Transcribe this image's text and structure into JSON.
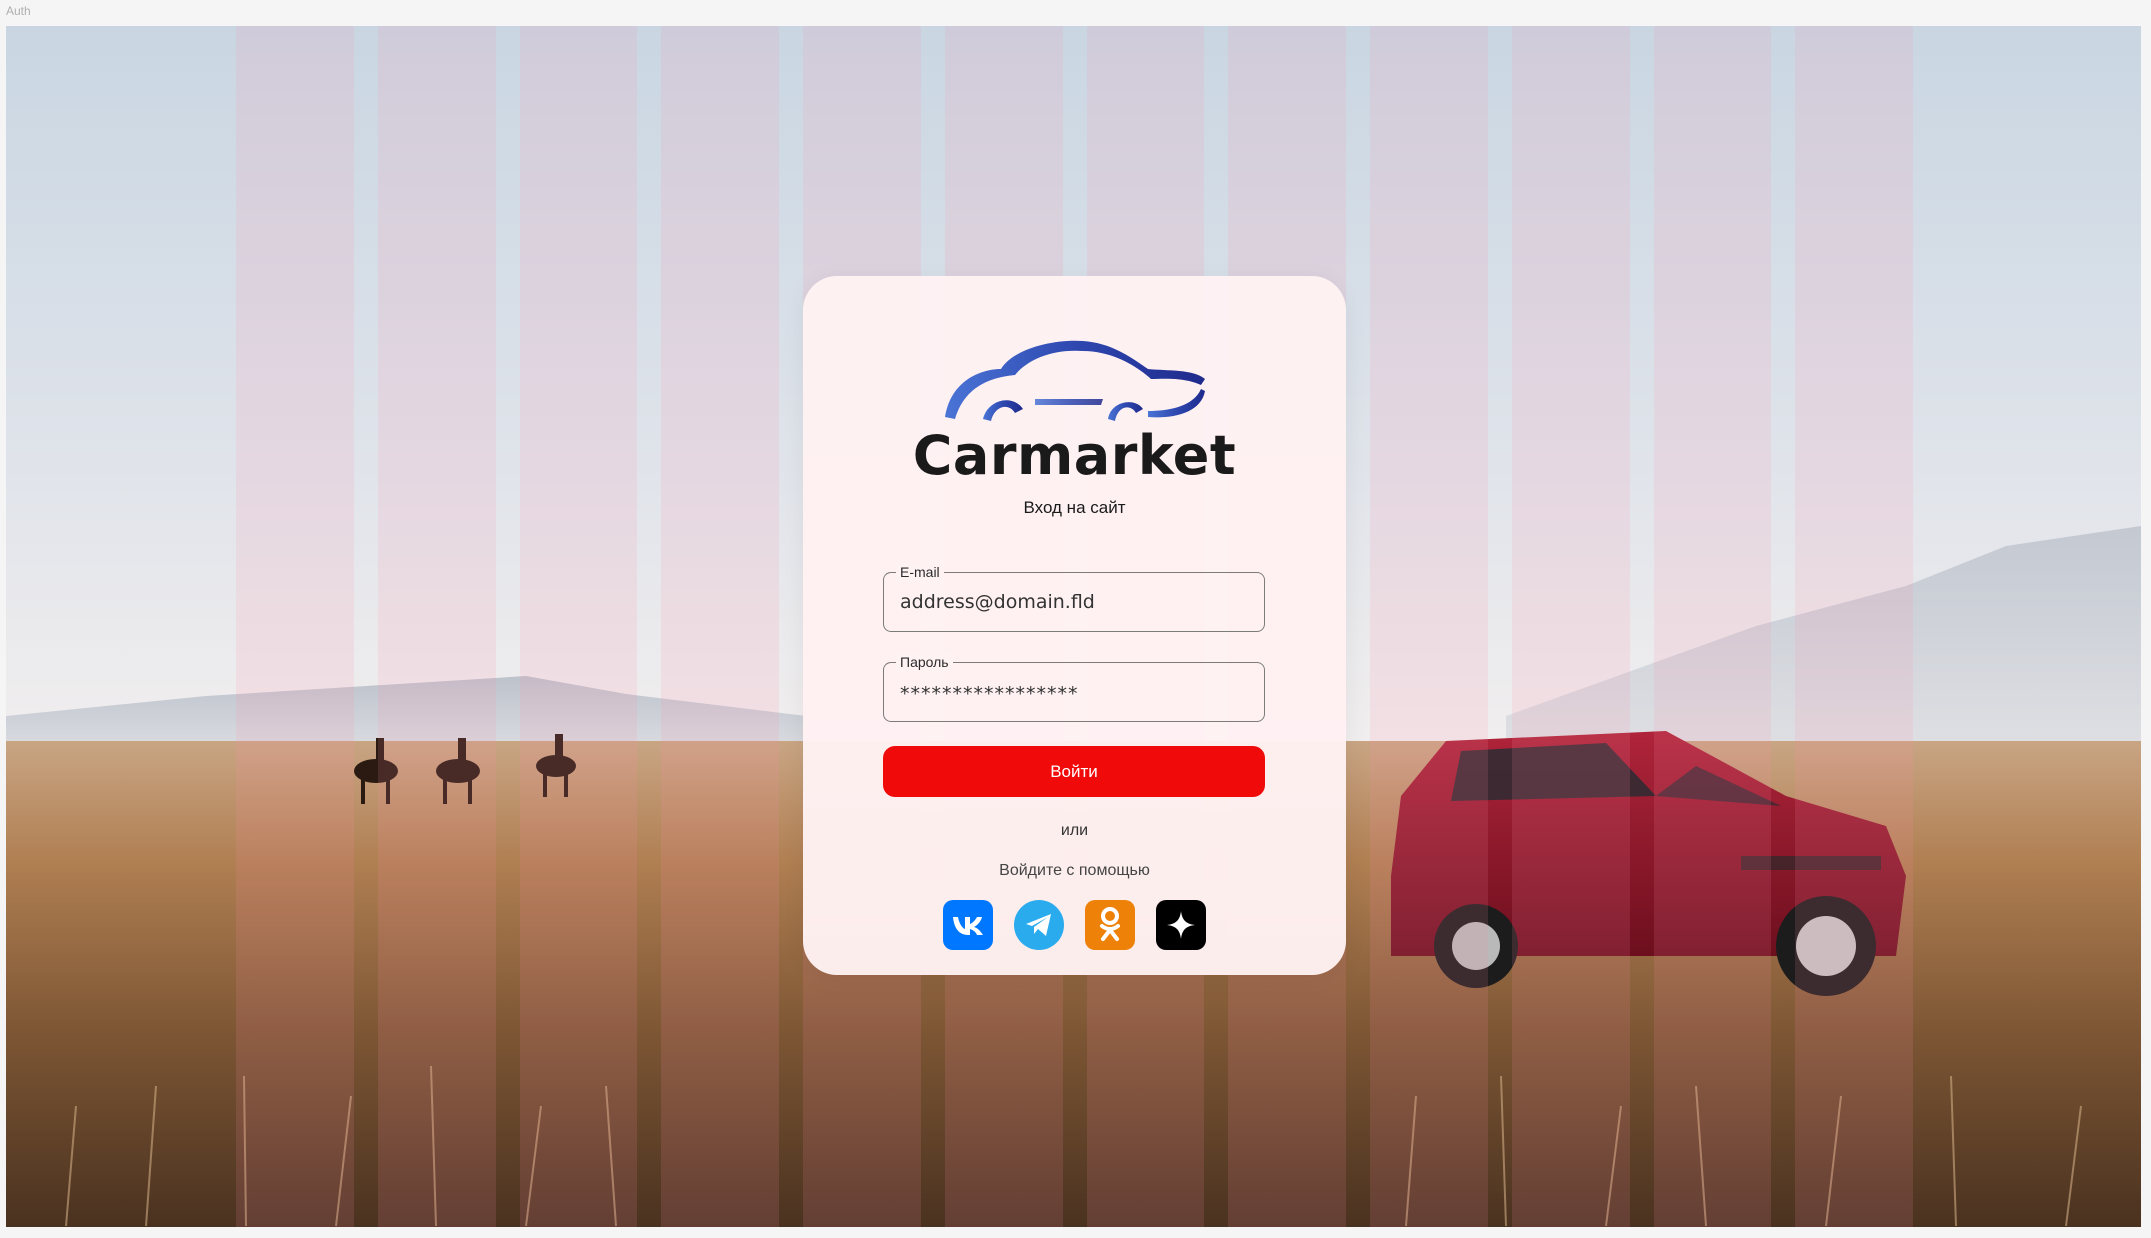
{
  "frame": {
    "label": "Auth"
  },
  "brand": {
    "name": "Carmarket"
  },
  "login": {
    "subtitle": "Вход на сайт",
    "email": {
      "label": "E-mail",
      "value": "address@domain.fld"
    },
    "password": {
      "label": "Пароль",
      "value": "*****************"
    },
    "submit_label": "Войти",
    "or_label": "или",
    "social_caption": "Войдите с помощью"
  },
  "socials": [
    {
      "name": "vk-icon",
      "color": "#0077ff"
    },
    {
      "name": "telegram-icon",
      "color": "#2aabee"
    },
    {
      "name": "odnoklassniki-icon",
      "color": "#ee8208"
    },
    {
      "name": "yandex-sparkle-icon",
      "color": "#000000"
    }
  ],
  "colors": {
    "accent": "#f00a0a",
    "card": "#fff2f3",
    "logo_gradient_start": "#3a5fcf",
    "logo_gradient_end": "#1f2a8c"
  }
}
